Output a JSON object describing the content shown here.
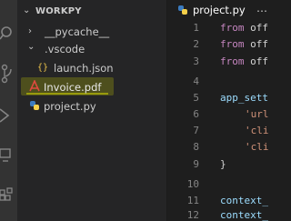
{
  "explorer": {
    "header_title": "WORKPY",
    "tree": [
      {
        "label": "__pycache__",
        "type": "folder",
        "collapsed": true
      },
      {
        "label": ".vscode",
        "type": "folder",
        "collapsed": false
      },
      {
        "label": "launch.json",
        "type": "json",
        "icon_text": "{}"
      },
      {
        "label": "Invoice.pdf",
        "type": "pdf"
      },
      {
        "label": "project.py",
        "type": "python"
      }
    ]
  },
  "editor": {
    "tab_label": "project.py",
    "tab_more": "…",
    "lines": [
      {
        "n": "1",
        "kw": "from",
        "rest": " off"
      },
      {
        "n": "2",
        "kw": "from",
        "rest": " off"
      },
      {
        "n": "3",
        "kw": "from",
        "rest": " off"
      },
      {
        "n": "4",
        "kw": "",
        "rest": ""
      },
      {
        "n": "5",
        "kw": "",
        "rest": "app_sett"
      },
      {
        "n": "6",
        "kw": "",
        "rest": "'url"
      },
      {
        "n": "7",
        "kw": "",
        "rest": "'cli"
      },
      {
        "n": "8",
        "kw": "",
        "rest": "'cli"
      },
      {
        "n": "9",
        "kw": "",
        "rest": "}"
      },
      {
        "n": "10",
        "kw": "",
        "rest": ""
      },
      {
        "n": "11",
        "kw": "",
        "rest": "context_"
      },
      {
        "n": "12",
        "kw": "",
        "rest": "context_"
      }
    ]
  },
  "colors": {
    "activity_bar": "#333333",
    "sidebar": "#252526",
    "editor": "#1e1e1e",
    "keyword": "#c586c0",
    "variable": "#9cdcfe",
    "string": "#ce9178",
    "line_number": "#858585",
    "pdf_icon": "#e04a3f",
    "python_icon": "#3b7bbf",
    "json_icon": "#e8c04a",
    "highlight": "#e2e600"
  }
}
